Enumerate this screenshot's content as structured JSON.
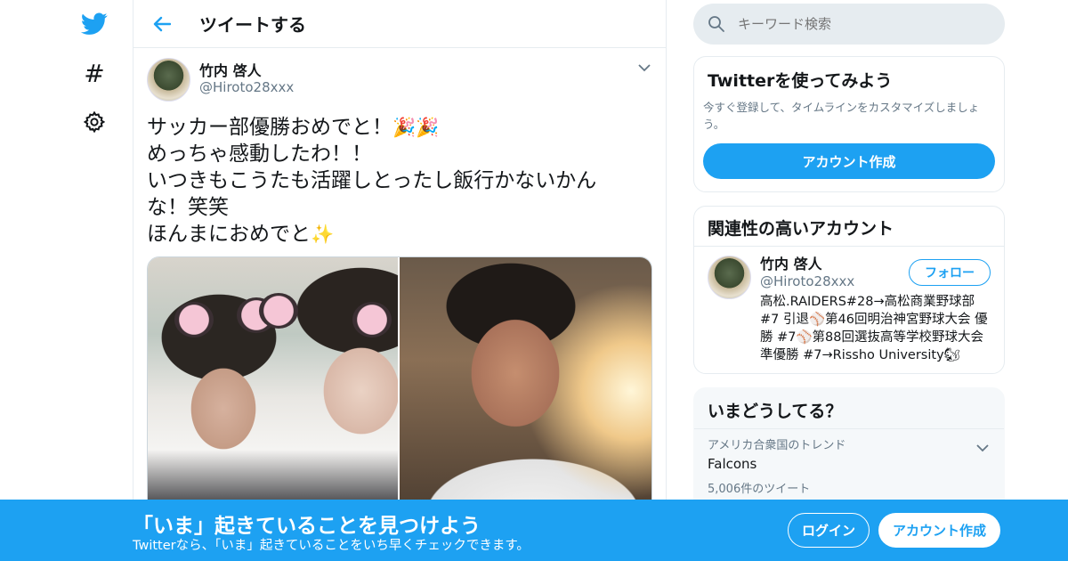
{
  "header": {
    "title": "ツイートする"
  },
  "nav": {
    "explore_glyph": "#",
    "icons": [
      "twitter-bird-icon",
      "hashtag-icon",
      "gear-icon"
    ]
  },
  "tweet": {
    "author_name": "竹内 啓人",
    "author_handle": "@Hiroto28xxx",
    "lines": [
      "サッカー部優勝おめでと！",
      "めっちゃ感動したわ！！",
      "いつきもこうたも活躍しとったし飯行かないかん",
      "な！笑笑",
      "ほんまにおめでと"
    ],
    "emoji_party": "🎉🎉",
    "emoji_sparkles": "✨"
  },
  "sidebar": {
    "search": {
      "placeholder": "キーワード検索"
    },
    "signup_card": {
      "title": "Twitterを使ってみよう",
      "description": "今すぐ登録して、タイムラインをカスタマイズしましょう。",
      "button": "アカウント作成"
    },
    "related": {
      "title": "関連性の高いアカウント",
      "user": {
        "name": "竹内 啓人",
        "handle": "@Hiroto28xxx",
        "follow_label": "フォロー",
        "bio": "高松.RAIDERS#28→高松商業野球部 #7 引退⚾第46回明治神宮野球大会 優勝 #7⚾第88回選抜高等学校野球大会 準優勝 #7→Rissho University🐿"
      }
    },
    "trends": {
      "title": "いまどうしてる？",
      "items": [
        {
          "context": "アメリカ合衆国のトレンド",
          "name": "Falcons",
          "count": "5,006件のツイート"
        }
      ]
    }
  },
  "bottom_bar": {
    "title": "「いま」起きていることを見つけよう",
    "subtitle": "Twitterなら、「いま」起きていることをいち早くチェックできます。",
    "login": "ログイン",
    "signup": "アカウント作成"
  },
  "colors": {
    "accent": "#1da1f2",
    "text": "#14171a",
    "muted": "#657786",
    "border": "#e6ecf0"
  }
}
